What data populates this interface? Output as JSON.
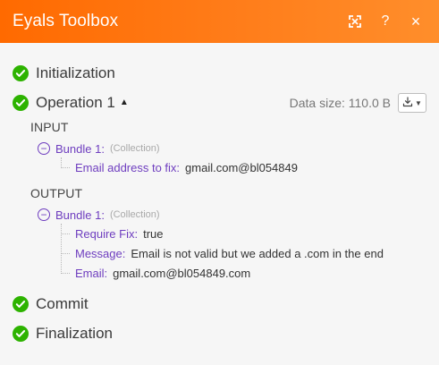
{
  "header": {
    "title": "Eyals Toolbox",
    "help_label": "?",
    "close_label": "×"
  },
  "steps": {
    "initialization": "Initialization",
    "operation": "Operation 1",
    "commit": "Commit",
    "finalization": "Finalization"
  },
  "operation": {
    "data_size_label": "Data size: 110.0 B",
    "caret": "▲",
    "input_title": "INPUT",
    "output_title": "OUTPUT",
    "input_bundle": {
      "label": "Bundle 1:",
      "type": "(Collection)",
      "fields": [
        {
          "key": "Email address to fix:",
          "value": "gmail.com@bl054849"
        }
      ]
    },
    "output_bundle": {
      "label": "Bundle 1:",
      "type": "(Collection)",
      "fields": [
        {
          "key": "Require Fix:",
          "value": "true"
        },
        {
          "key": "Message:",
          "value": "Email is not valid but we added a .com in the end"
        },
        {
          "key": "Email:",
          "value": "gmail.com@bl054849.com"
        }
      ]
    }
  },
  "colors": {
    "header_start": "#ff6a00",
    "header_end": "#ff8e2b",
    "success_green": "#2db300",
    "bundle_purple": "#6e3dbf"
  },
  "icons": {
    "expand": "expand-icon",
    "help": "help-icon",
    "close": "close-icon",
    "success": "check-circle-icon",
    "download": "download-icon",
    "collapse_bundle": "minus-circle-icon"
  }
}
